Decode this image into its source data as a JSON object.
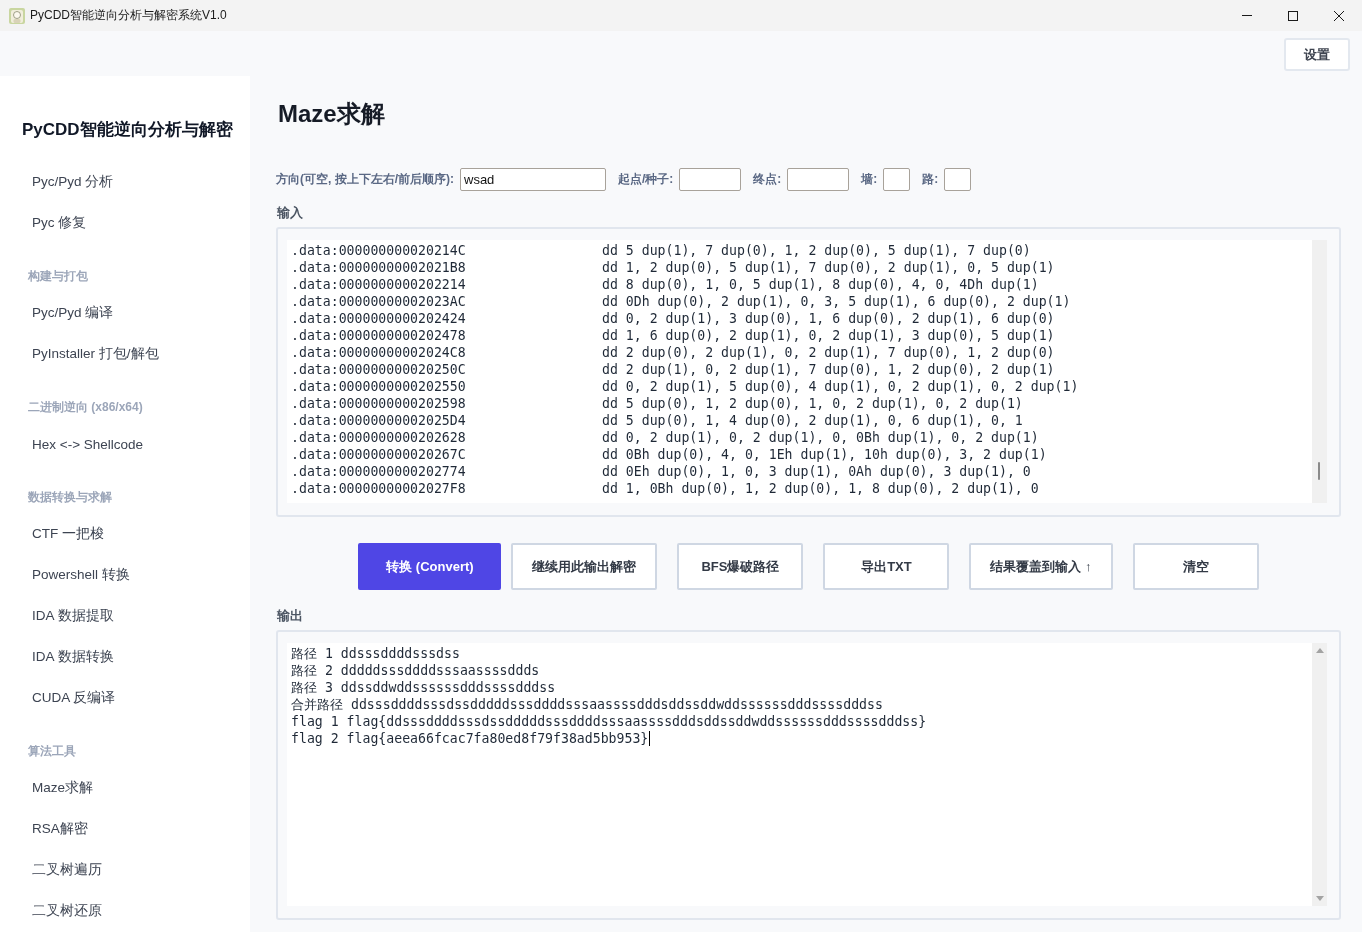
{
  "window": {
    "title": "PyCDD智能逆向分析与解密系统V1.0"
  },
  "toolbar": {
    "settings_button": "设置"
  },
  "sidebar": {
    "title": "PyCDD智能逆向分析与解密",
    "groups": [
      {
        "items": [
          {
            "label": "Pyc/Pyd 分析",
            "selected": false
          },
          {
            "label": "Pyc 修复",
            "selected": false
          }
        ]
      },
      {
        "heading": "构建与打包",
        "items": [
          {
            "label": "Pyc/Pyd 编译",
            "selected": false
          },
          {
            "label": "PyInstaller 打包/解包",
            "selected": false
          }
        ]
      },
      {
        "heading": "二进制逆向 (x86/x64)",
        "items": [
          {
            "label": "Hex <-> Shellcode",
            "selected": false
          }
        ]
      },
      {
        "heading": "数据转换与求解",
        "items": [
          {
            "label": "CTF 一把梭",
            "selected": false
          },
          {
            "label": "Powershell 转换",
            "selected": false
          },
          {
            "label": "IDA 数据提取",
            "selected": false
          },
          {
            "label": "IDA 数据转换",
            "selected": false
          },
          {
            "label": "CUDA 反编译",
            "selected": false
          }
        ]
      },
      {
        "heading": "算法工具",
        "items": [
          {
            "label": "Maze求解",
            "selected": false
          },
          {
            "label": "RSA解密",
            "selected": false
          },
          {
            "label": "二叉树遍历",
            "selected": false
          },
          {
            "label": "二叉树还原",
            "selected": false
          }
        ]
      }
    ]
  },
  "page": {
    "title": "Maze求解",
    "params": [
      {
        "label": "方向(可空, 按上下左右/前后顺序):",
        "kind": "wide",
        "value": "wsad"
      },
      {
        "label": "起点/种子:",
        "kind": "medium"
      },
      {
        "label": "终点:",
        "kind": "medium"
      },
      {
        "label": "墙:",
        "kind": "narrow"
      },
      {
        "label": "路:",
        "kind": "narrow"
      }
    ],
    "input": {
      "label": "输入",
      "lines": [
        {
          "address": ".data:000000000020214C",
          "code": "dd 5 dup(1), 7 dup(0), 1, 2 dup(0), 5 dup(1), 7 dup(0)"
        },
        {
          "address": ".data:00000000002021B8",
          "code": "dd 1, 2 dup(0), 5 dup(1), 7 dup(0), 2 dup(1), 0, 5 dup(1)"
        },
        {
          "address": ".data:0000000000202214",
          "code": "dd 8 dup(0), 1, 0, 5 dup(1), 8 dup(0), 4, 0, 4Dh dup(1)"
        },
        {
          "address": ".data:00000000002023AC",
          "code": "dd 0Dh dup(0), 2 dup(1), 0, 3, 5 dup(1), 6 dup(0), 2 dup(1)"
        },
        {
          "address": ".data:0000000000202424",
          "code": "dd 0, 2 dup(1), 3 dup(0), 1, 6 dup(0), 2 dup(1), 6 dup(0)"
        },
        {
          "address": ".data:0000000000202478",
          "code": "dd 1, 6 dup(0), 2 dup(1), 0, 2 dup(1), 3 dup(0), 5 dup(1)"
        },
        {
          "address": ".data:00000000002024C8",
          "code": "dd 2 dup(0), 2 dup(1), 0, 2 dup(1), 7 dup(0), 1, 2 dup(0)"
        },
        {
          "address": ".data:000000000020250C",
          "code": "dd 2 dup(1), 0, 2 dup(1), 7 dup(0), 1, 2 dup(0), 2 dup(1)"
        },
        {
          "address": ".data:0000000000202550",
          "code": "dd 0, 2 dup(1), 5 dup(0), 4 dup(1), 0, 2 dup(1), 0, 2 dup(1)"
        },
        {
          "address": ".data:0000000000202598",
          "code": "dd 5 dup(0), 1, 2 dup(0), 1, 0, 2 dup(1), 0, 2 dup(1)"
        },
        {
          "address": ".data:00000000002025D4",
          "code": "dd 5 dup(0), 1, 4 dup(0), 2 dup(1), 0, 6 dup(1), 0, 1"
        },
        {
          "address": ".data:0000000000202628",
          "code": "dd 0, 2 dup(1), 0, 2 dup(1), 0, 0Bh dup(1), 0, 2 dup(1)"
        },
        {
          "address": ".data:000000000020267C",
          "code": "dd 0Bh dup(0), 4, 0, 1Eh dup(1), 10h dup(0), 3, 2 dup(1)"
        },
        {
          "address": ".data:0000000000202774",
          "code": "dd 0Eh dup(0), 1, 0, 3 dup(1), 0Ah dup(0), 3 dup(1), 0"
        },
        {
          "address": ".data:00000000002027F8",
          "code": "dd 1, 0Bh dup(0), 1, 2 dup(0), 1, 8 dup(0), 2 dup(1), 0"
        }
      ]
    },
    "actions": [
      {
        "label": "转换 (Convert)",
        "primary": true
      },
      {
        "label": "继续用此输出解密",
        "primary": false
      },
      {
        "label": "BFS爆破路径",
        "primary": false
      },
      {
        "label": "导出TXT",
        "primary": false
      },
      {
        "label": "结果覆盖到输入 ↑",
        "primary": false
      },
      {
        "label": "清空",
        "primary": false
      }
    ],
    "output": {
      "label": "输出",
      "focused": true,
      "lines": [
        "路径 1 ddsssddddsssdss",
        "路径 2 dddddsssddddsssaassssddds",
        "路径 3 ddssddwddssssssdddssssdddss",
        "合并路径 ddsssddddsssdssdddddsssddddsssaassssdddsddssddwddssssssdddssssdddss",
        "flag 1 flag{ddsssddddsssdssdddddsssddddsssaassssdddsddssddwddssssssdddssssdddss}",
        "flag 2 flag{aeea66fcac7fa80ed8f79f38ad5bb953}"
      ]
    }
  }
}
